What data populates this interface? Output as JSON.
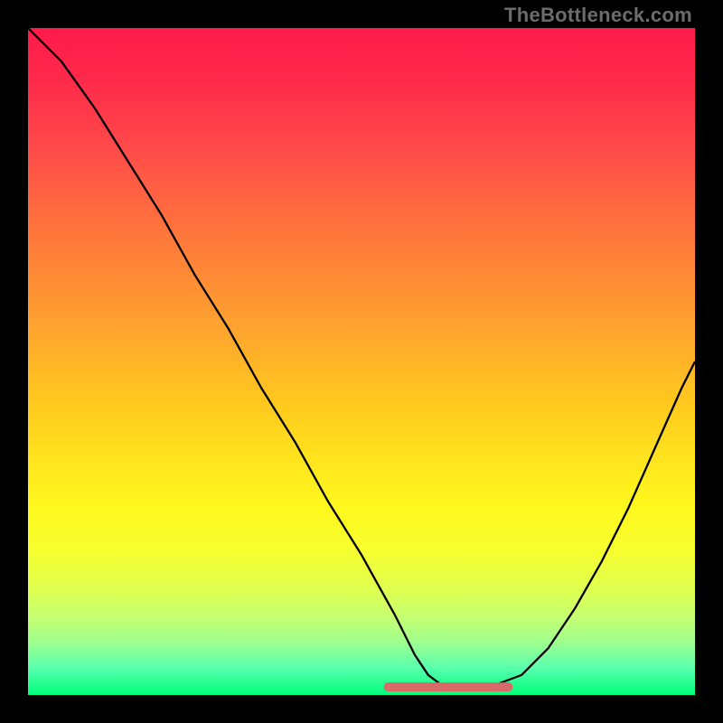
{
  "watermark": "TheBottleneck.com",
  "colors": {
    "frame": "#000000",
    "gradient_top": "#ff1a4a",
    "gradient_mid": "#ffe81e",
    "gradient_bottom": "#00ff7a",
    "curve": "#000000",
    "dip_highlight": "#d96a6a"
  },
  "chart_data": {
    "type": "line",
    "title": "",
    "xlabel": "",
    "ylabel": "",
    "xlim": [
      0,
      100
    ],
    "ylim": [
      0,
      100
    ],
    "x": [
      0,
      5,
      10,
      15,
      20,
      25,
      30,
      35,
      40,
      45,
      50,
      55,
      58,
      60,
      62,
      64,
      66,
      70,
      74,
      78,
      82,
      86,
      90,
      94,
      98,
      100
    ],
    "values": [
      100,
      95,
      88,
      80,
      72,
      63,
      55,
      46,
      38,
      29,
      21,
      12,
      6,
      3,
      1.5,
      1,
      1,
      1.5,
      3,
      7,
      13,
      20,
      28,
      37,
      46,
      50
    ],
    "highlight_x_range": [
      54,
      72
    ],
    "note": "V-shaped bottleneck curve; y is bottleneck percentage (100 = worst, 0 = optimal). Highlighted flat segment near the minimum marks the balanced range."
  }
}
